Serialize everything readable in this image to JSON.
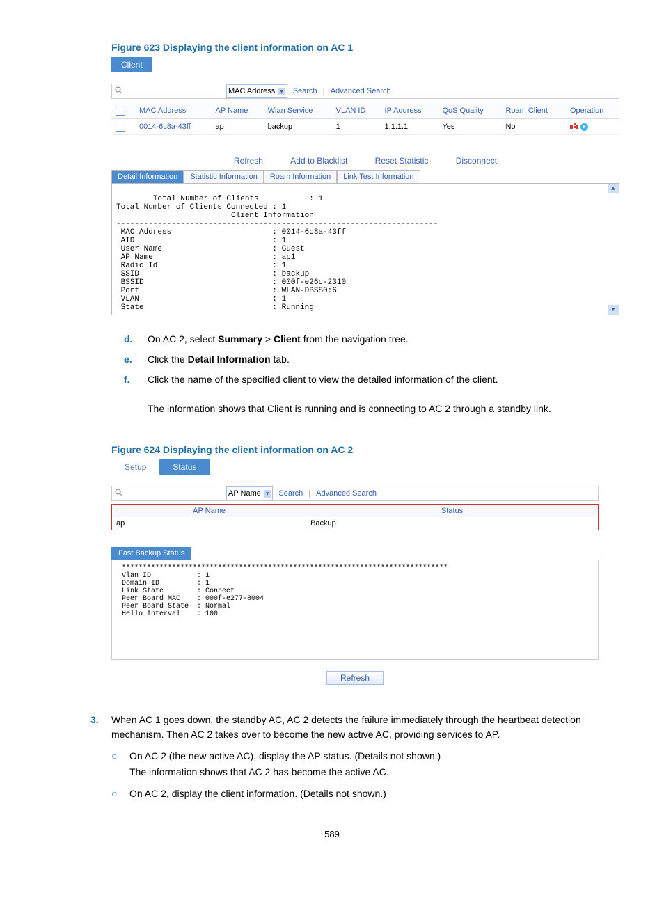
{
  "fig623": {
    "title": "Figure 623 Displaying the client information on AC 1",
    "topTab": "Client",
    "search": {
      "dropdown": "MAC Address",
      "searchBtn": "Search",
      "advanced": "Advanced Search"
    },
    "tableHeaders": [
      "",
      "MAC Address",
      "AP Name",
      "Wlan Service",
      "VLAN ID",
      "IP Address",
      "QoS Quality",
      "Roam Client",
      "Operation"
    ],
    "row": {
      "mac": "0014-6c8a-43ff",
      "ap": "ap",
      "wlan": "backup",
      "vlan": "1",
      "ip": "1.1.1.1",
      "qos": "Yes",
      "roam": "No"
    },
    "actions": {
      "refresh": "Refresh",
      "blacklist": "Add to Blacklist",
      "reset": "Reset Statistic",
      "disconnect": "Disconnect"
    },
    "infoTabs": {
      "detail": "Detail Information",
      "statistic": "Statistic Information",
      "roam": "Roam Information",
      "linktest": "Link Test Information"
    },
    "detailText": "Total Number of Clients           : 1\nTotal Number of Clients Connected : 1\n                         Client Information\n----------------------------------------------------------------------\n MAC Address                      : 0014-6c8a-43ff\n AID                              : 1\n User Name                        : Guest\n AP Name                          : ap1\n Radio Id                         : 1\n SSID                             : backup\n BSSID                            : 000f-e26c-2310\n Port                             : WLAN-DBSS0:6\n VLAN                             : 1\n State                            : Running"
  },
  "steps1": {
    "d": {
      "letter": "d.",
      "text_pre": "On AC 2, select ",
      "bold1": "Summary",
      "sep": " > ",
      "bold2": "Client",
      "text_post": " from the navigation tree."
    },
    "e": {
      "letter": "e.",
      "text_pre": "Click the ",
      "bold1": "Detail Information",
      "text_post": " tab."
    },
    "f": {
      "letter": "f.",
      "text": "Click the name of the specified client to view the detailed information of the client.",
      "text2": "The information shows that Client is running and is connecting to AC 2 through a standby link."
    }
  },
  "fig624": {
    "title": "Figure 624 Displaying the client information on AC 2",
    "tabs": {
      "setup": "Setup",
      "status": "Status"
    },
    "search": {
      "dropdown": "AP Name",
      "searchBtn": "Search",
      "advanced": "Advanced Search"
    },
    "tableHeaders": {
      "apname": "AP Name",
      "status": "Status"
    },
    "row": {
      "ap": "ap",
      "status": "Backup"
    },
    "backupTab": "Fast Backup Status",
    "backupText": " ******************************************************************************\n Vlan ID           : 1\n Domain ID         : 1\n Link State        : Connect\n Peer Board MAC    : 000f-e277-8004\n Peer Board State  : Normal\n Hello Interval    : 100",
    "refreshBtn": "Refresh"
  },
  "num3": {
    "no": "3.",
    "text": "When AC 1 goes down, the standby AC, AC 2 detects the failure immediately through the heartbeat detection mechanism. Then AC 2 takes over to become the new active AC, providing services to AP.",
    "b1": "On AC 2 (the new active AC), display the AP status. (Details not shown.)",
    "b1sub": "The information shows that AC 2 has become the active AC.",
    "b2": "On AC 2, display the client information. (Details not shown.)"
  },
  "pageNumber": "589"
}
